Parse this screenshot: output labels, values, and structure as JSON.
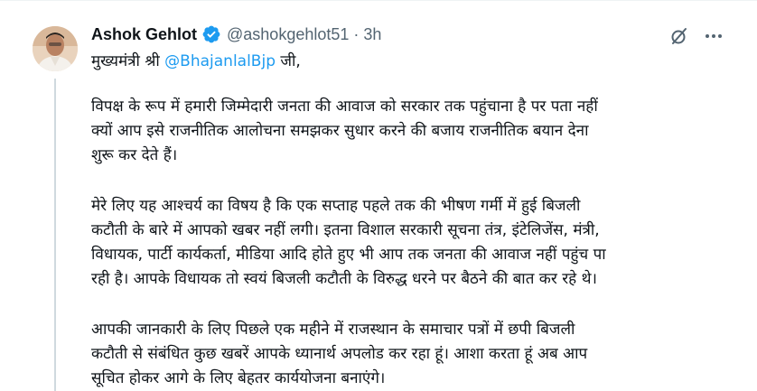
{
  "tweet": {
    "author": {
      "display_name": "Ashok Gehlot",
      "handle": "@ashokgehlot51",
      "separator": "·",
      "time": "3h",
      "verified": true,
      "verified_color": "#1d9bf0"
    },
    "icons": {
      "grok": "grok-slash-icon",
      "more": "more-dots-icon"
    },
    "salutation": {
      "prefix": "मुख्यमंत्री श्री ",
      "mention": "@BhajanlalBjp",
      "suffix": " जी,"
    },
    "paragraphs": [
      {
        "lines": [
          "विपक्ष के रूप में हमारी जिम्मेदारी जनता की आवाज को सरकार तक पहुंचाना है पर पता नहीं",
          "क्यों आप इसे राजनीतिक आलोचना समझकर सुधार करने की बजाय राजनीतिक बयान देना",
          "शुरू कर देते हैं।"
        ]
      },
      {
        "lines": [
          "मेरे लिए यह आश्चर्य का विषय है कि एक सप्ताह पहले तक की भीषण गर्मी में हुई बिजली",
          "कटौती के बारे में आपको खबर नहीं लगी। इतना विशाल सरकारी सूचना तंत्र, इंटेलिजेंस, मंत्री,",
          "विधायक, पार्टी कार्यकर्ता, मीडिया आदि होते हुए भी आप तक जनता की आवाज नहीं पहुंच पा",
          "रही है। आपके विधायक तो स्वयं बिजली कटौती के विरुद्ध धरने पर बैठने की बात कर रहे थे।"
        ]
      },
      {
        "lines": [
          "आपकी जानकारी के लिए पिछले एक महीने में राजस्थान के समाचार पत्रों में छपी बिजली",
          "कटौती से संबंधित कुछ खबरें आपके ध्यानार्थ अपलोड कर रहा हूं। आशा करता हूं अब आप",
          "सूचित होकर आगे के लिए बेहतर कार्ययोजना बनाएंगे।"
        ]
      }
    ]
  }
}
